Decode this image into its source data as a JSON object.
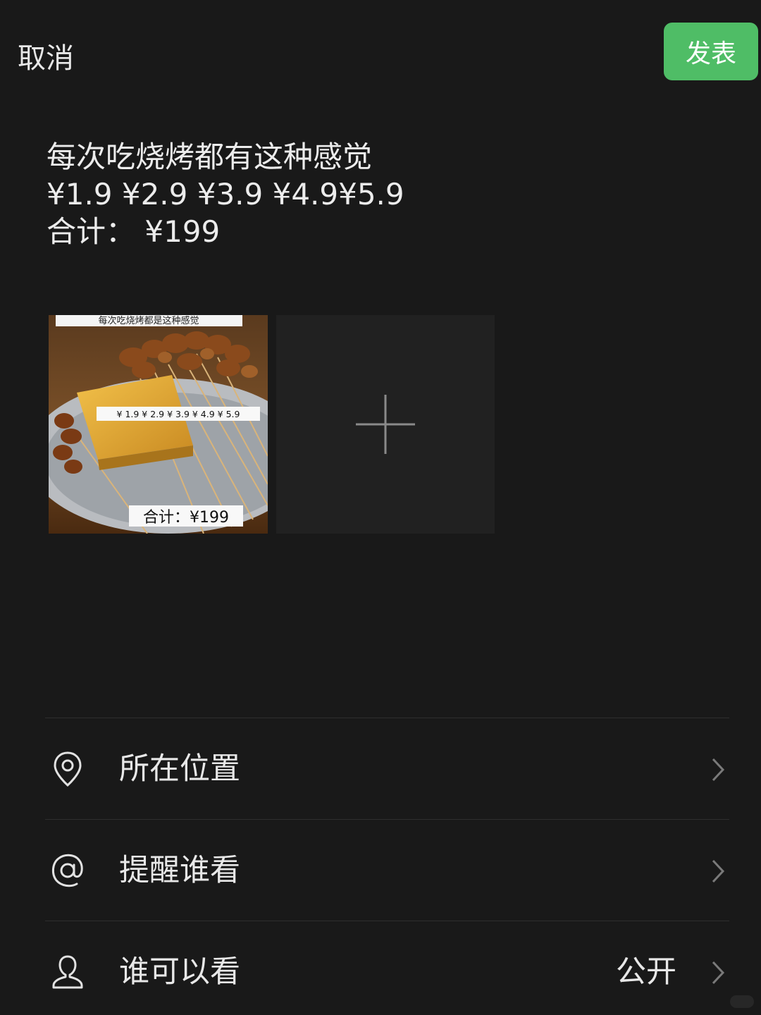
{
  "header": {
    "cancel_label": "取消",
    "publish_label": "发表",
    "publish_color": "#4fbd66"
  },
  "post": {
    "lines": [
      "每次吃烧烤都有这种感觉",
      "¥1.9 ¥2.9 ¥3.9 ¥4.9¥5.9",
      "合计：  ¥199"
    ]
  },
  "attachments": {
    "photo": {
      "caption_top": "每次吃烧烤都是这种感觉",
      "caption_prices": "¥ 1.9 ¥ 2.9 ¥ 3.9 ¥ 4.9 ¥ 5.9",
      "caption_total": "合计：¥199"
    },
    "add_icon": "plus-icon"
  },
  "options": [
    {
      "icon": "location-pin-icon",
      "label": "所在位置",
      "value": ""
    },
    {
      "icon": "at-sign-icon",
      "label": "提醒谁看",
      "value": ""
    },
    {
      "icon": "person-icon",
      "label": "谁可以看",
      "value": "公开"
    }
  ],
  "colors": {
    "background": "#191919",
    "add_tile": "#212121",
    "text": "#e8e8e8",
    "divider": "#2f2f2f"
  }
}
